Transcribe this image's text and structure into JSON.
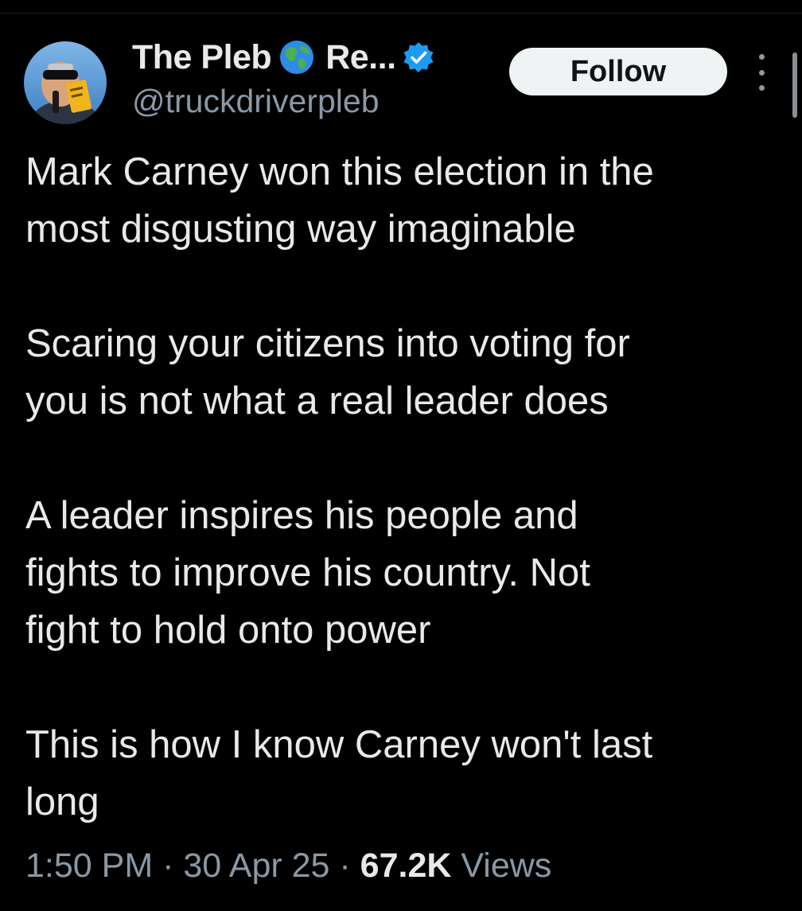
{
  "author": {
    "display_name": "The Pleb",
    "name_truncated": "Re...",
    "handle": "@truckdriverpleb",
    "icons": [
      "globe-icon",
      "verified-icon",
      "avatar"
    ]
  },
  "header": {
    "follow_label": "Follow",
    "more_icon": "more-options-icon"
  },
  "tweet": {
    "paragraphs": [
      "Mark Carney won this election in the\nmost disgusting way imaginable",
      "Scaring your citizens into voting for\nyou is not what a real leader does",
      "A leader inspires his people and\nfights to improve his country. Not\nfight to hold onto power",
      "This is how I know Carney won't last\nlong"
    ]
  },
  "meta": {
    "time": "1:50 PM",
    "sep1": " · ",
    "date": "30 Apr 25",
    "sep2": " · ",
    "views_count": "67.2K",
    "views_label": " Views"
  },
  "colors": {
    "background": "#000000",
    "text_primary": "#e7e9ea",
    "text_secondary": "#8b98a5",
    "verified_blue": "#1d9bf0",
    "follow_bg": "#eff3f4"
  }
}
